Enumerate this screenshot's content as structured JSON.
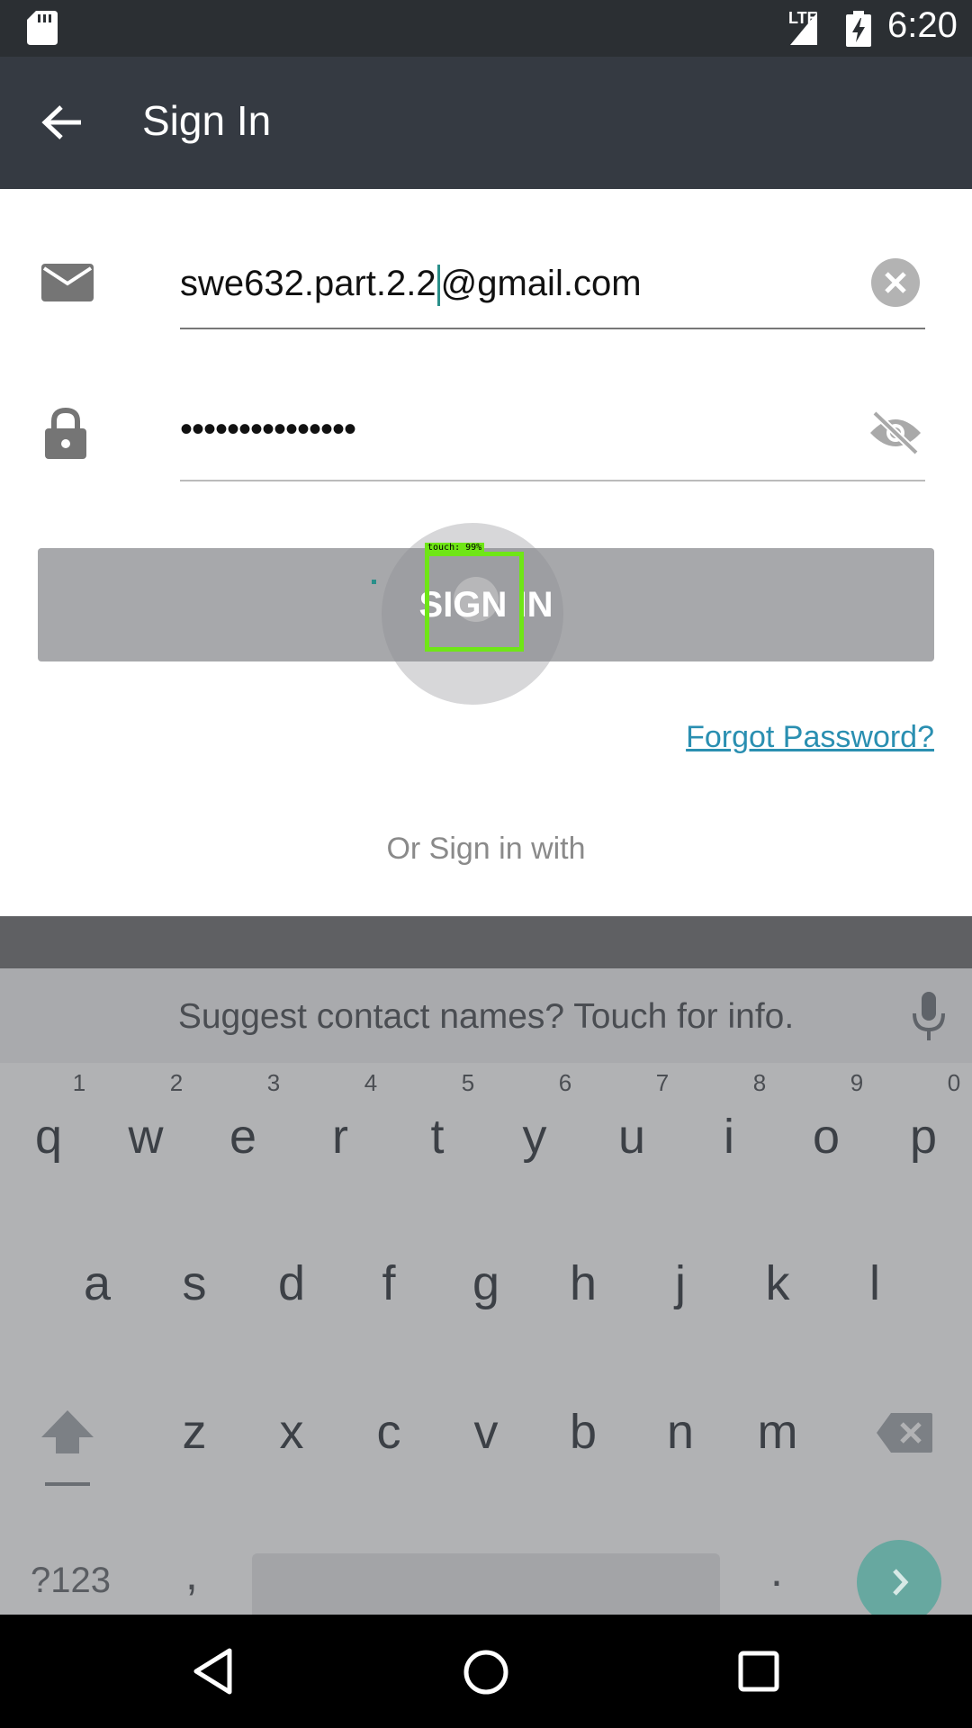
{
  "status_bar": {
    "network_label": "LTE",
    "time": "6:20",
    "icons": [
      "sd-card-icon",
      "signal-icon",
      "battery-charging-icon"
    ]
  },
  "app_bar": {
    "title": "Sign In",
    "back_icon": "arrow-back-icon"
  },
  "form": {
    "email": {
      "icon": "mail-icon",
      "value": "swe632.part.2.2@gmail.com",
      "value_before_cursor": "swe632.part.2.2",
      "value_after_cursor": "@gmail.com",
      "clear_icon": "clear-icon"
    },
    "password": {
      "icon": "lock-icon",
      "masked_value": "•••••••••••••••",
      "visibility_icon": "visibility-off-icon"
    },
    "sign_in_label": "SIGN IN",
    "touch_indicator_label": "touch: 99%",
    "forgot_password_label": "Forgot Password?",
    "or_sign_in_with_label": "Or Sign in with"
  },
  "keyboard": {
    "suggestion": "Suggest contact names? Touch for info.",
    "row1": [
      "q",
      "w",
      "e",
      "r",
      "t",
      "y",
      "u",
      "i",
      "o",
      "p"
    ],
    "row1_numbers": [
      "1",
      "2",
      "3",
      "4",
      "5",
      "6",
      "7",
      "8",
      "9",
      "0"
    ],
    "row2": [
      "a",
      "s",
      "d",
      "f",
      "g",
      "h",
      "j",
      "k",
      "l"
    ],
    "row3": [
      "z",
      "x",
      "c",
      "v",
      "b",
      "n",
      "m"
    ],
    "symbols_label": "?123",
    "comma": ",",
    "period": ".",
    "accent_color": "#4aa79a"
  },
  "colors": {
    "app_bar": "#353a42",
    "status_bar": "#2b2f33",
    "link": "#2a8fb1",
    "touch_box": "#6fe616"
  }
}
